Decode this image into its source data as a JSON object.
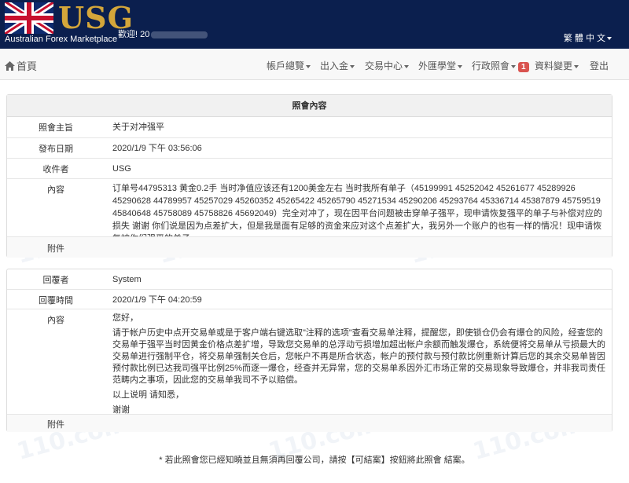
{
  "header": {
    "logo_text": "USG",
    "tagline": "Australian Forex Marketplace",
    "welcome": "歡迎! 20",
    "language": "繁 體 中 文"
  },
  "nav": {
    "home": "首頁",
    "items": [
      {
        "label": "帳戶總覽"
      },
      {
        "label": "出入金"
      },
      {
        "label": "交易中心"
      },
      {
        "label": "外匯學堂"
      },
      {
        "label": "行政照會",
        "badge": "1"
      },
      {
        "label": "資料變更"
      },
      {
        "label": "登出"
      }
    ]
  },
  "notice": {
    "title": "照會內容",
    "subject_label": "照會主旨",
    "subject": "关于对冲强平",
    "date_label": "發布日期",
    "date": "2020/1/9 下午 03:56:06",
    "recipient_label": "收件者",
    "recipient": "USG",
    "content_label": "內容",
    "content": "订单号44795313 黄金0.2手 当时净值应该还有1200美金左右 当时我所有单子（45199991 45252042 45261677 45289926 45290628 44789957 45257029 45260352 45265422 45265790 45271534 45290206 45293764 45336714 45387879 45759519 45840648 45758089 45758826 45692049）完全对冲了，现在因平台问题被击穿单子强平，现申请恢复强平的单子与补偿对应的损失 谢谢 你们说是因为点差扩大，但是我是面有足够的资金来应对这个点差扩大，我另外一个账户的也有一样的情况！现申请恢复被你们强平的单子",
    "attachment_label": "附件",
    "attachment": ""
  },
  "reply": {
    "replier_label": "回覆者",
    "replier": "System",
    "time_label": "回覆時間",
    "time": "2020/1/9 下午 04:20:59",
    "content_label": "內容",
    "greeting": "您好，",
    "body": "请于帐户历史中点开交易单或是于客户端右键选取\"注释的选项\"查看交易单注释，提醒您，即使锁仓仍会有爆仓的风险，经查您的交易单于强平当时因黄金价格点差扩增，导致您交易单的总浮动亏损增加超出帐户余额而触发爆仓，系统便将交易单从亏损最大的交易单进行强制平仓，将交易单强制关仓后，您帐户不再是所合状态，帐户的预付款与预付款比例重新计算后您的其余交易单皆因预付款比例已达我司强平比例25%而逐一爆仓，经查并无异常，您的交易单系因外汇市场正常的交易现象导致爆仓，并非我司责任范畴内之事项，因此您的交易单我司不予以赔偿。",
    "closing1": "以上说明   请知悉，",
    "closing2": "谢谢",
    "attachment_label": "附件",
    "attachment": ""
  },
  "footer": {
    "note": "* 若此照會您已經知曉並且無須再回覆公司，請按【可結案】按鈕將此照會 結案。"
  },
  "watermark": "110.com",
  "colors": {
    "header_bg": "#0b1f4e",
    "logo_gold": "#d4a63a",
    "badge_red": "#d9534f"
  }
}
